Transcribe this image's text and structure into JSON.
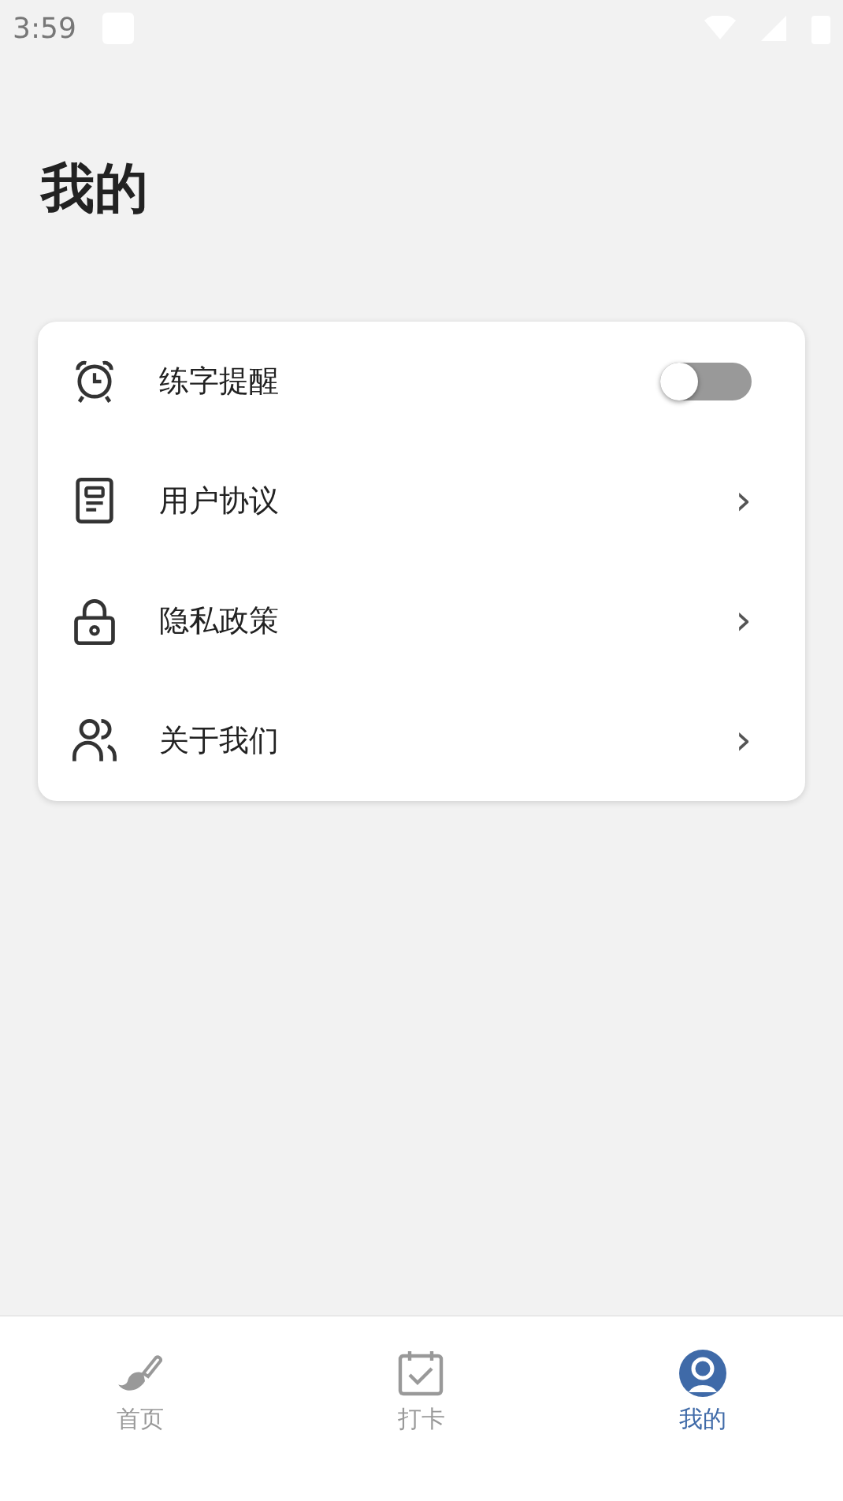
{
  "status_bar": {
    "time": "3:59"
  },
  "title": "我的",
  "settings": [
    {
      "kind": "toggle",
      "label": "练字提醒",
      "on": false
    },
    {
      "kind": "link",
      "label": "用户协议",
      "arrow": "›"
    },
    {
      "kind": "link",
      "label": "隐私政策",
      "arrow": "›"
    },
    {
      "kind": "link",
      "label": "关于我们",
      "arrow": "›"
    }
  ],
  "nav": [
    {
      "label": "首页",
      "selected": false
    },
    {
      "label": "打卡",
      "selected": false
    },
    {
      "label": "我的",
      "selected": true
    }
  ]
}
